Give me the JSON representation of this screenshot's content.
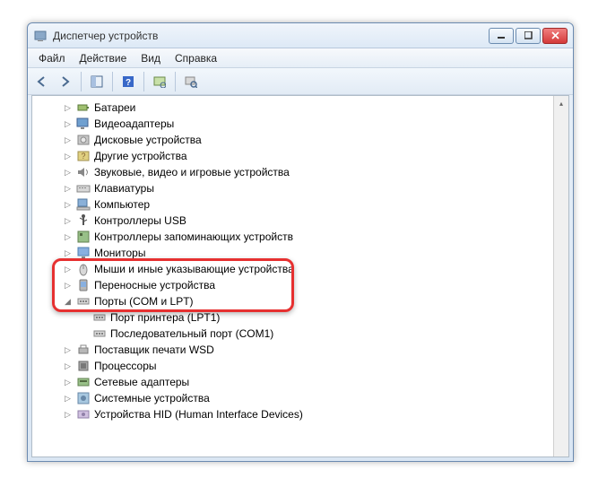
{
  "window": {
    "title": "Диспетчер устройств"
  },
  "menu": {
    "items": [
      "Файл",
      "Действие",
      "Вид",
      "Справка"
    ]
  },
  "tree": {
    "items": [
      {
        "label": "Батареи",
        "icon": "battery",
        "depth": 1,
        "expanded": false
      },
      {
        "label": "Видеоадаптеры",
        "icon": "display",
        "depth": 1,
        "expanded": false
      },
      {
        "label": "Дисковые устройства",
        "icon": "disk",
        "depth": 1,
        "expanded": false
      },
      {
        "label": "Другие устройства",
        "icon": "other",
        "depth": 1,
        "expanded": false
      },
      {
        "label": "Звуковые, видео и игровые устройства",
        "icon": "sound",
        "depth": 1,
        "expanded": false
      },
      {
        "label": "Клавиатуры",
        "icon": "keyboard",
        "depth": 1,
        "expanded": false
      },
      {
        "label": "Компьютер",
        "icon": "computer",
        "depth": 1,
        "expanded": false
      },
      {
        "label": "Контроллеры USB",
        "icon": "usb",
        "depth": 1,
        "expanded": false
      },
      {
        "label": "Контроллеры запоминающих устройств",
        "icon": "storage",
        "depth": 1,
        "expanded": false
      },
      {
        "label": "Мониторы",
        "icon": "monitor",
        "depth": 1,
        "expanded": false
      },
      {
        "label": "Мыши и иные указывающие устройства",
        "icon": "mouse",
        "depth": 1,
        "expanded": false
      },
      {
        "label": "Переносные устройства",
        "icon": "portable",
        "depth": 1,
        "expanded": false
      },
      {
        "label": "Порты (COM и LPT)",
        "icon": "port",
        "depth": 1,
        "expanded": true
      },
      {
        "label": "Порт принтера (LPT1)",
        "icon": "port",
        "depth": 2,
        "leaf": true
      },
      {
        "label": "Последовательный порт (COM1)",
        "icon": "port",
        "depth": 2,
        "leaf": true
      },
      {
        "label": "Поставщик печати WSD",
        "icon": "printer",
        "depth": 1,
        "expanded": false
      },
      {
        "label": "Процессоры",
        "icon": "cpu",
        "depth": 1,
        "expanded": false
      },
      {
        "label": "Сетевые адаптеры",
        "icon": "network",
        "depth": 1,
        "expanded": false
      },
      {
        "label": "Системные устройства",
        "icon": "system",
        "depth": 1,
        "expanded": false
      },
      {
        "label": "Устройства HID (Human Interface Devices)",
        "icon": "hid",
        "depth": 1,
        "expanded": false
      }
    ]
  }
}
